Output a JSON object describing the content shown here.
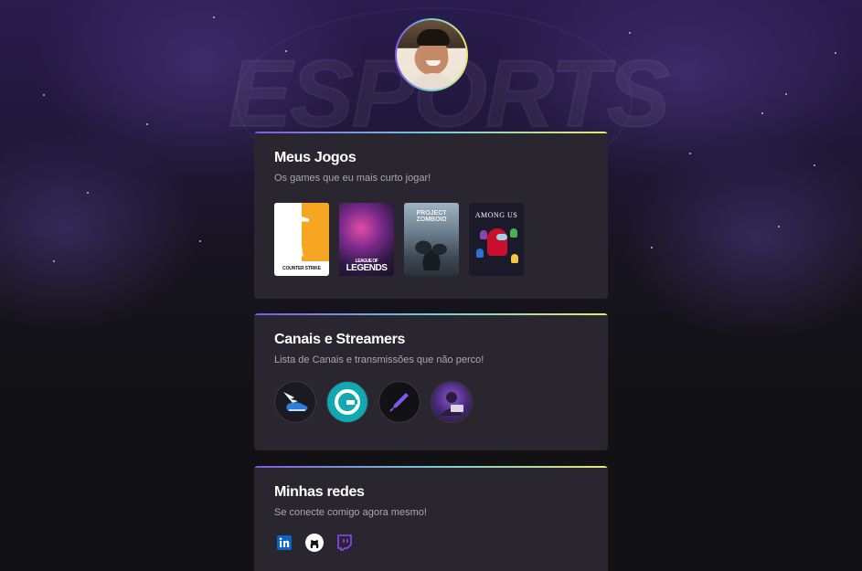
{
  "profile": {
    "avatar_alt": "Foto de perfil"
  },
  "background": {
    "watermark": "ESPORTS"
  },
  "games_card": {
    "title": "Meus Jogos",
    "subtitle": "Os games que eu mais curto jogar!",
    "games": [
      {
        "name": "Counter-Strike",
        "logo_text": "COUNTER STRIKE"
      },
      {
        "name": "League of Legends",
        "logo_small": "LEAGUE OF",
        "logo_big": "LEGENDS"
      },
      {
        "name": "Project Zomboid",
        "logo_text": "PROJECT ZOMBOID"
      },
      {
        "name": "Among Us",
        "logo_text": "AMONG US"
      }
    ]
  },
  "channels_card": {
    "title": "Canais e Streamers",
    "subtitle": "Lista de Canais e transmissões que não perco!",
    "channels": [
      {
        "icon": "winged-shoe-icon"
      },
      {
        "icon": "refresh-g-icon"
      },
      {
        "icon": "rocket-pen-icon"
      },
      {
        "icon": "streamer-avatar-icon"
      }
    ]
  },
  "socials_card": {
    "title": "Minhas redes",
    "subtitle": "Se conecte comigo agora mesmo!",
    "links": [
      {
        "icon": "linkedin-icon",
        "color": "#0a66c2"
      },
      {
        "icon": "github-icon",
        "color": "#ffffff"
      },
      {
        "icon": "twitch-icon",
        "color": "#9146ff"
      }
    ]
  },
  "colors": {
    "accent_gradient": [
      "#8257e6",
      "#6ecdd7",
      "#ebe76c"
    ],
    "card_bg": "#29262f",
    "page_bg": "#121214",
    "subtitle": "#a8a8b3"
  }
}
